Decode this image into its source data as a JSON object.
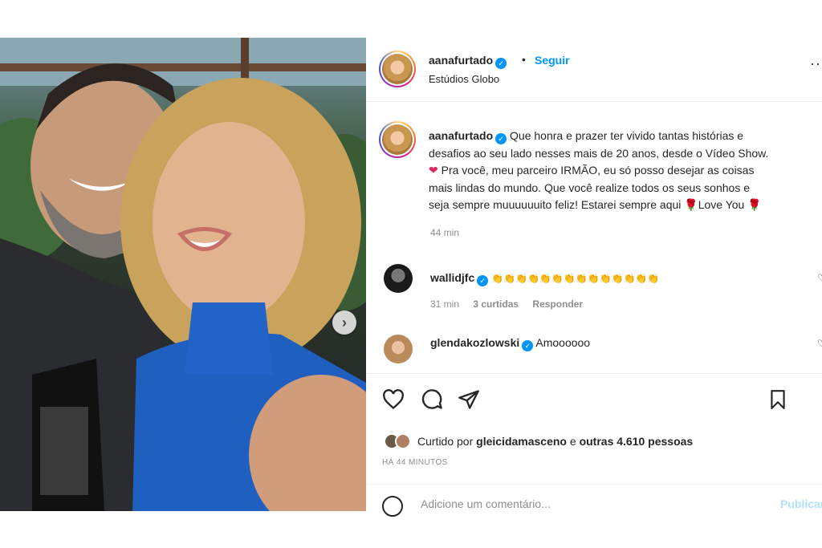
{
  "post": {
    "author": "aanafurtado",
    "follow_label": "Seguir",
    "dot": "•",
    "location": "Estúdios Globo",
    "more": "··"
  },
  "caption": {
    "username": "aanafurtado",
    "line1": "Que honra e prazer ter vivido tantas histórias e",
    "line2": "desafios ao seu lado nesses mais de 20 anos, desde o Vídeo Show.",
    "heart": "❤",
    "line3": " Pra você, meu parceiro IRMÃO, eu só posso desejar as coisas",
    "line4": "mais lindas do mundo. Que você realize todos os seus sonhos e",
    "line5a": "seja sempre muuuuuuito feliz! Estarei sempre aqui ",
    "rose": "🌹",
    "line5b": "Love You ",
    "time": "44 min"
  },
  "comments": [
    {
      "username": "wallidjfc",
      "text": "👏👏👏👏👏👏👏👏👏👏👏👏👏👏",
      "time": "31 min",
      "likes": "3 curtidas",
      "reply": "Responder"
    },
    {
      "username": "glendakozlowski",
      "text": "Amoooooo"
    }
  ],
  "likes": {
    "prefix": "Curtido por ",
    "user": "gleicidamasceno",
    "middle": " e ",
    "others": "outras 4.610 pessoas"
  },
  "timestamp": "HÁ 44 MINUTOS",
  "add_comment": {
    "placeholder": "Adicione um comentário...",
    "publish": "Publicar"
  },
  "colors": {
    "link_blue": "#0095f6",
    "verified_blue": "#0095f6",
    "muted": "#8e8e8e"
  },
  "icons": [
    "verified-icon",
    "heart-icon",
    "comment-icon",
    "share-icon",
    "bookmark-icon",
    "emoji-icon",
    "chevron-right-icon"
  ]
}
